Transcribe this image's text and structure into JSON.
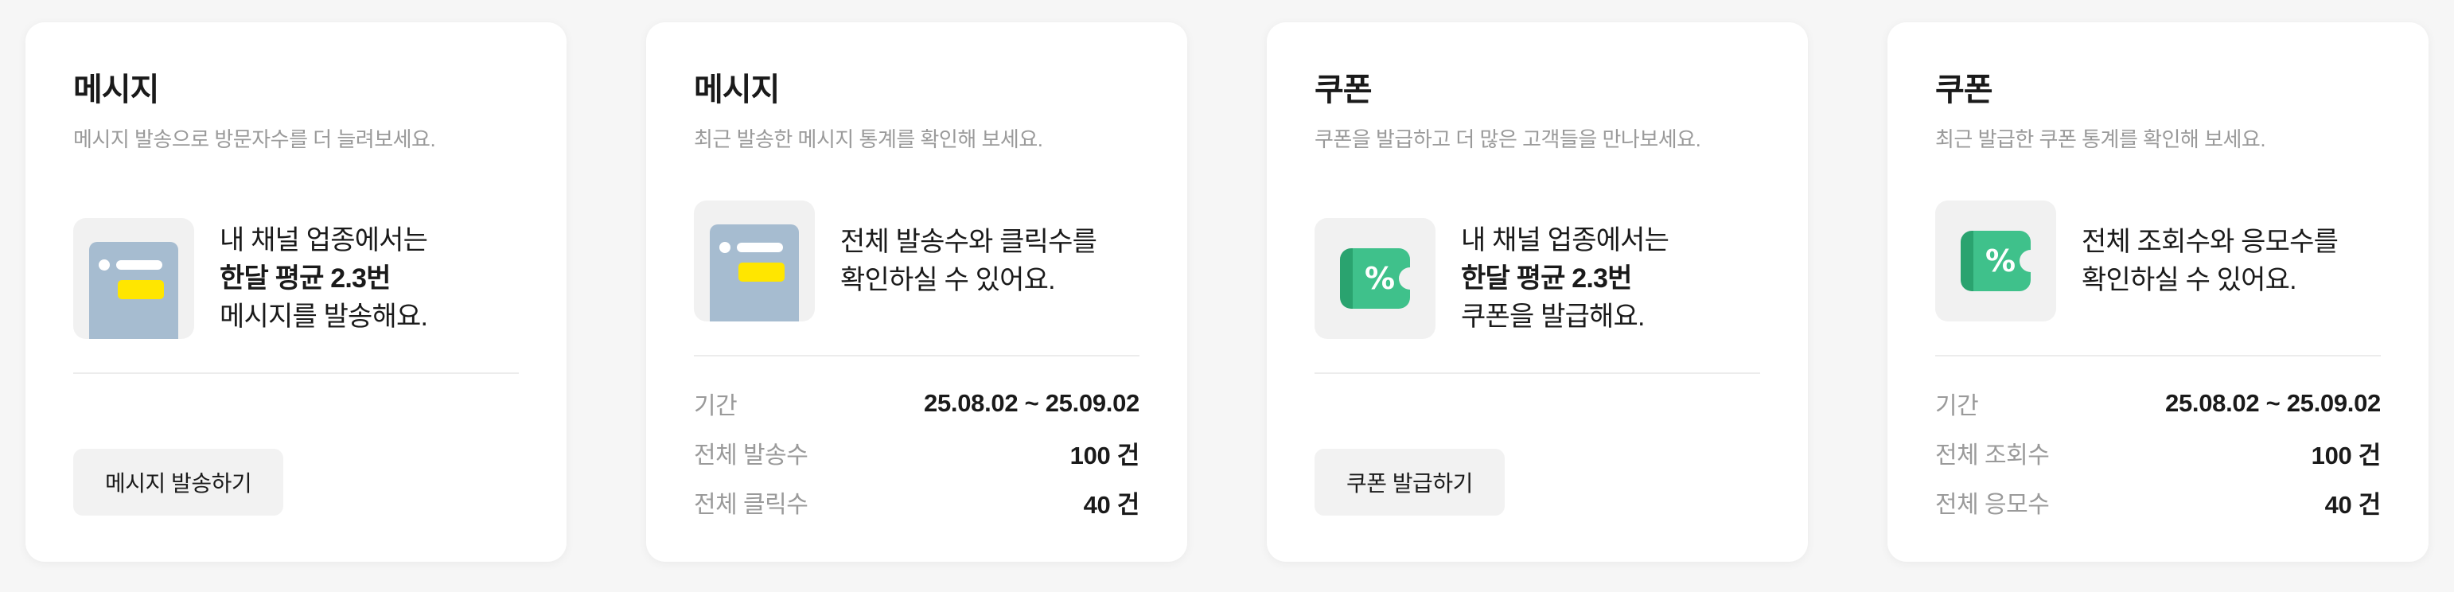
{
  "cards": [
    {
      "title": "메시지",
      "subtitle": "메시지 발송으로 방문자수를 더 늘려보세요.",
      "icon": "message-document-icon",
      "promo_line1": "내 채널 업종에서는",
      "promo_line2": "한달 평균 2.3번",
      "promo_line3": "메시지를 발송해요.",
      "button_label": "메시지 발송하기"
    },
    {
      "title": "메시지",
      "subtitle": "최근 발송한 메시지 통계를 확인해 보세요.",
      "icon": "message-document-icon",
      "promo_line1": "전체 발송수와 클릭수를",
      "promo_line2": "확인하실 수 있어요.",
      "stats": [
        {
          "label": "기간",
          "value": "25.08.02 ~ 25.09.02"
        },
        {
          "label": "전체 발송수",
          "value": "100 건"
        },
        {
          "label": "전체 클릭수",
          "value": "40 건"
        }
      ]
    },
    {
      "title": "쿠폰",
      "subtitle": "쿠폰을 발급하고 더 많은 고객들을 만나보세요.",
      "icon": "coupon-ticket-icon",
      "promo_line1": "내 채널 업종에서는",
      "promo_line2": "한달 평균 2.3번",
      "promo_line3": "쿠폰을 발급해요.",
      "button_label": "쿠폰 발급하기"
    },
    {
      "title": "쿠폰",
      "subtitle": "최근 발급한 쿠폰 통계를 확인해 보세요.",
      "icon": "coupon-ticket-icon",
      "promo_line1": "전체 조회수와 응모수를",
      "promo_line2": "확인하실 수 있어요.",
      "stats": [
        {
          "label": "기간",
          "value": "25.08.02 ~ 25.09.02"
        },
        {
          "label": "전체 조회수",
          "value": "100 건"
        },
        {
          "label": "전체 응모수",
          "value": "40 건"
        }
      ]
    }
  ],
  "colors": {
    "document_blue": "#a6bcd0",
    "highlight_yellow": "#ffe600",
    "coupon_green": "#3fc18b",
    "subtitle_gray": "#9a9a9a"
  }
}
